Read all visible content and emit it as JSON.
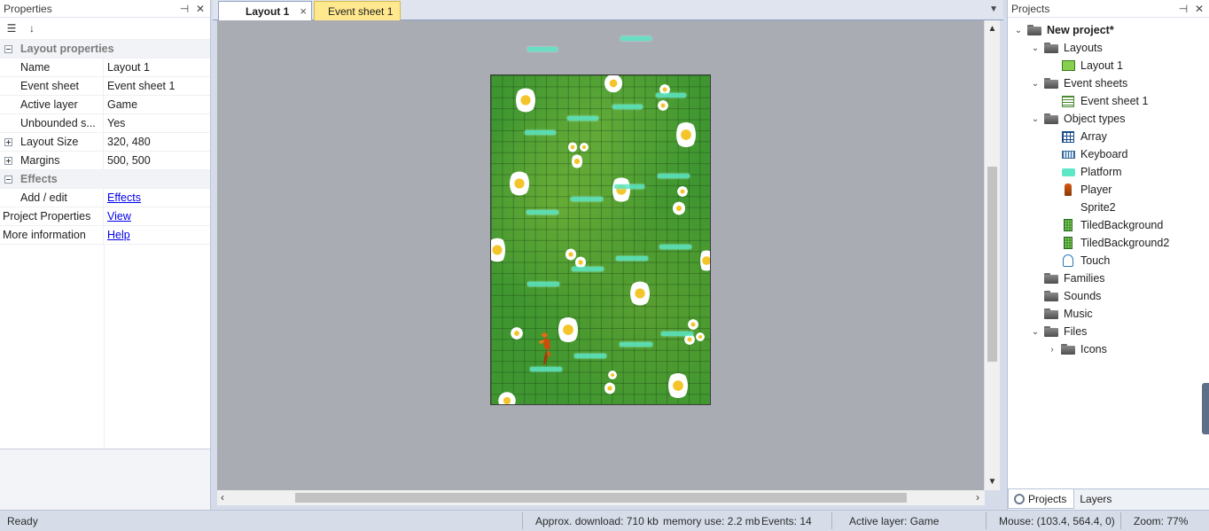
{
  "properties_panel": {
    "title": "Properties",
    "pin_icon": "pin-icon",
    "close_icon": "close-icon",
    "categories": {
      "layout": "Layout properties",
      "effects": "Effects"
    },
    "rows": [
      {
        "key": "Name",
        "value": "Layout 1"
      },
      {
        "key": "Event sheet",
        "value": "Event sheet 1"
      },
      {
        "key": "Active layer",
        "value": "Game"
      },
      {
        "key": "Unbounded s...",
        "value": "Yes"
      },
      {
        "key": "Layout Size",
        "value": "320, 480"
      },
      {
        "key": "Margins",
        "value": "500, 500"
      }
    ],
    "effects_row": {
      "key": "Add / edit",
      "value": "Effects"
    },
    "project_properties": {
      "key": "Project Properties",
      "value": "View"
    },
    "more_information": {
      "key": "More information",
      "value": "Help"
    }
  },
  "tabs": {
    "layout": "Layout 1",
    "close": "×",
    "event_sheet": "Event sheet 1"
  },
  "projects_panel": {
    "title": "Projects",
    "tree": {
      "project": "New project*",
      "layouts": "Layouts",
      "layout_1": "Layout 1",
      "event_sheets": "Event sheets",
      "event_sheet_1": "Event sheet 1",
      "object_types": "Object types",
      "objects": [
        "Array",
        "Keyboard",
        "Platform",
        "Player",
        "Sprite2",
        "TiledBackground",
        "TiledBackground2",
        "Touch"
      ],
      "families": "Families",
      "sounds": "Sounds",
      "music": "Music",
      "files": "Files",
      "icons": "Icons"
    },
    "bottom_tabs": [
      "Projects",
      "Layers"
    ]
  },
  "status_bar": {
    "state": "Ready",
    "download": "Approx. download: 710 kb",
    "memory": "memory use: 2.2 mb",
    "events": "Events: 14",
    "active_layer": "Active layer: Game",
    "mouse": "Mouse: (103.4, 564.4, 0)",
    "zoom": "Zoom: 77%"
  },
  "colors": {
    "accent": "#8da0c4",
    "layout_tab": "#ffffff",
    "event_tab": "#ffe88e",
    "platform": "#5de7c6",
    "grass": "#3f9630",
    "viewport": "#a9acb3"
  }
}
